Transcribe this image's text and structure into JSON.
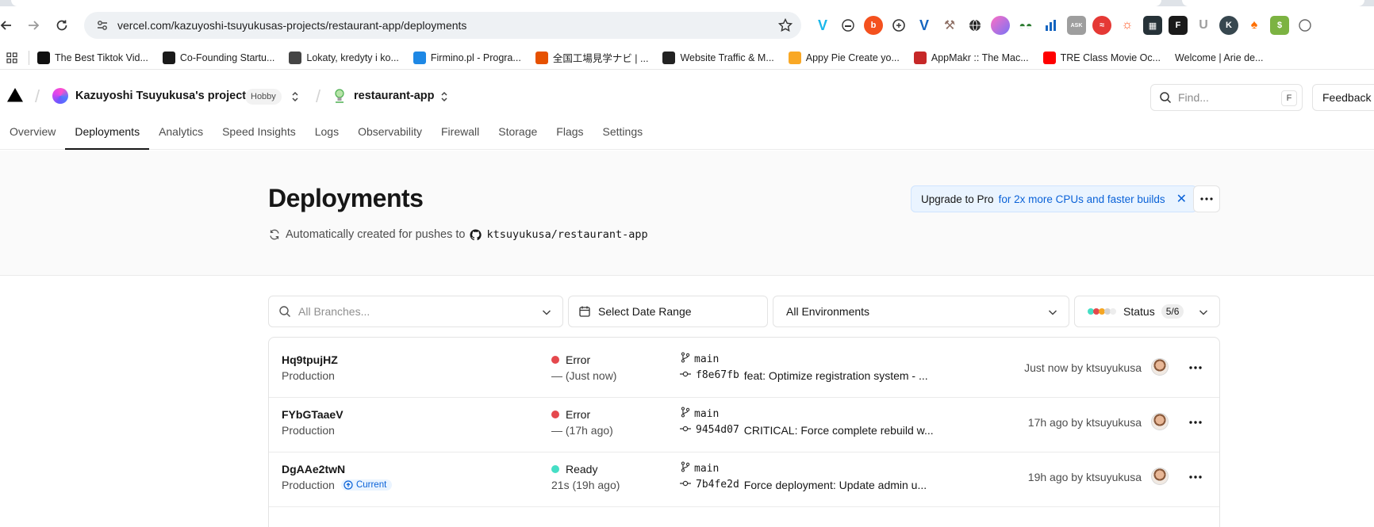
{
  "browser": {
    "url": "vercel.com/kazuyoshi-tsuyukusas-projects/restaurant-app/deployments",
    "bookmarks": [
      {
        "label": "The Best Tiktok Vid...",
        "icon": "tiktok-icon",
        "color": "#111111"
      },
      {
        "label": "Co-Founding Startu...",
        "icon": "w-logo-icon",
        "color": "#1a1a1a"
      },
      {
        "label": "Lokaty, kredyty i ko...",
        "icon": "globe-icon",
        "color": "#444444"
      },
      {
        "label": "Firmino.pl - Progra...",
        "icon": "s-logo-icon",
        "color": "#1e88e5"
      },
      {
        "label": "全国工場見学ナビ | ...",
        "icon": "k-logo-icon",
        "color": "#e65100"
      },
      {
        "label": "Website Traffic & M...",
        "icon": "similarweb-icon",
        "color": "#222222"
      },
      {
        "label": "Appy Pie Create yo...",
        "icon": "appypie-icon",
        "color": "#f9a825"
      },
      {
        "label": "AppMakr :: The Mac...",
        "icon": "appmakr-icon",
        "color": "#c62828"
      },
      {
        "label": "TRE Class Movie Oc...",
        "icon": "youtube-icon",
        "color": "#ff0000"
      },
      {
        "label": "Welcome | Arie de...",
        "icon": "none",
        "color": "#ffffff"
      }
    ]
  },
  "header": {
    "team_name": "Kazuyoshi Tsuyukusa's projects",
    "plan_badge": "Hobby",
    "project_name": "restaurant-app",
    "find_placeholder": "Find...",
    "find_shortcut": "F",
    "feedback_label": "Feedback"
  },
  "tabs": [
    {
      "label": "Overview",
      "active": false
    },
    {
      "label": "Deployments",
      "active": true
    },
    {
      "label": "Analytics",
      "active": false
    },
    {
      "label": "Speed Insights",
      "active": false
    },
    {
      "label": "Logs",
      "active": false
    },
    {
      "label": "Observability",
      "active": false
    },
    {
      "label": "Firewall",
      "active": false
    },
    {
      "label": "Storage",
      "active": false
    },
    {
      "label": "Flags",
      "active": false
    },
    {
      "label": "Settings",
      "active": false
    }
  ],
  "page": {
    "title": "Deployments",
    "subtitle": "Automatically created for pushes to",
    "repo": "ktsuyukusa/restaurant-app",
    "upgrade_strong": "Upgrade to Pro",
    "upgrade_rest": "for 2x more CPUs and faster builds"
  },
  "filters": {
    "branches_placeholder": "All Branches...",
    "date_range": "Select Date Range",
    "environments": "All Environments",
    "status_label": "Status",
    "status_count": "5/6"
  },
  "deployments": [
    {
      "id": "Hq9tpujHZ",
      "environment": "Production",
      "current": false,
      "current_label": "",
      "status": "Error",
      "status_color": "#e5484d",
      "status_detail": "— (Just now)",
      "branch": "main",
      "sha": "f8e67fb",
      "message": "feat: Optimize registration system - ...",
      "when": "Just now by ktsuyukusa"
    },
    {
      "id": "FYbGTaaeV",
      "environment": "Production",
      "current": false,
      "current_label": "",
      "status": "Error",
      "status_color": "#e5484d",
      "status_detail": "— (17h ago)",
      "branch": "main",
      "sha": "9454d07",
      "message": "CRITICAL: Force complete rebuild w...",
      "when": "17h ago by ktsuyukusa"
    },
    {
      "id": "DgAAe2twN",
      "environment": "Production",
      "current": true,
      "current_label": "Current",
      "status": "Ready",
      "status_color": "#45dec5",
      "status_detail": "21s (19h ago)",
      "branch": "main",
      "sha": "7b4fe2d",
      "message": "Force deployment: Update admin u...",
      "when": "19h ago by ktsuyukusa"
    }
  ]
}
